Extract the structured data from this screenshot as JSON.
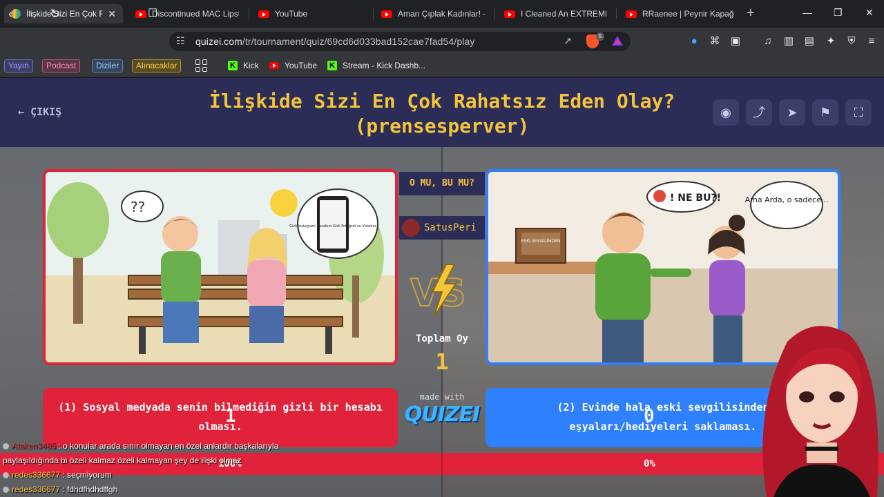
{
  "browser": {
    "tabs": [
      {
        "label": "İlişkide Sizi En Çok Ra",
        "active": true
      },
      {
        "label": "Discontinued MAC Lipst"
      },
      {
        "label": "YouTube"
      },
      {
        "label": "Aman Çıplak Kadınlar! -"
      },
      {
        "label": "I Cleaned An EXTREMEL"
      },
      {
        "label": "RRaenee | Peynir Kapağ"
      }
    ],
    "new_tab": "+",
    "url_host": "quizei.com",
    "url_path": "/tr/tournament/quiz/69cd6d033bad152cae7fad54/play",
    "brave_badge": "5",
    "bookmark_chips": [
      {
        "label": "Yayın",
        "color": "#9aa2ff"
      },
      {
        "label": "Podcast",
        "color": "#ff8fb1"
      },
      {
        "label": "Diziler",
        "color": "#9ad0ff"
      },
      {
        "label": "Alınacaklar",
        "color": "#ffd34d"
      }
    ],
    "bookmarks": [
      {
        "label": "Kick",
        "icon": "kick-icon"
      },
      {
        "label": "YouTube",
        "icon": "youtube-icon"
      },
      {
        "label": "Stream - Kick Dashb...",
        "icon": "kick-icon"
      }
    ]
  },
  "quiz": {
    "exit_label": "ÇIKIŞ",
    "title_line1": "İlişkide Sizi En Çok Rahatsız Eden Olay?",
    "title_line2": "(prensesperver)",
    "center_prompt": "O MU, BU MU?",
    "streamer_name": "SatusPeri",
    "total_label": "Toplam Oy",
    "total_value": "1",
    "made_with": "made with",
    "brand": "QUIZEI",
    "left": {
      "text": "(1) Sosyal medyada senin bilmediğin gizli bir hesabı olması.",
      "votes": "1",
      "percent_label": "100%",
      "percent": 100,
      "image_texts": {
        "bubble": "??",
        "phone": "Gizli Instagram Hesabım Gizli Fotoğraf ve Videolar"
      }
    },
    "right": {
      "text": "(2) Evinde hala eski sevgilisinden eşyaları/hediyeleri saklaması.",
      "votes": "0",
      "percent_label": "0%",
      "percent": 0,
      "image_texts": {
        "box": "ESKİ SEVGİLİMDEN",
        "angry": "! NE BU?!",
        "reply": "Ama Arda, o sadece..."
      }
    }
  },
  "chat": [
    {
      "user": "Ataken3485",
      "message": ": o konular arada sınır olmayan en özel anlardır başkalarıyla"
    },
    {
      "user": "",
      "message": "paylaşıldığında bi özeli kalmaz özeli kalmayan şey de ilişki olmaz"
    },
    {
      "user": "redes336677",
      "message": ": seçmiyorum"
    },
    {
      "user": "redes336677",
      "message": ": fdhdfhdhdffgh"
    }
  ]
}
